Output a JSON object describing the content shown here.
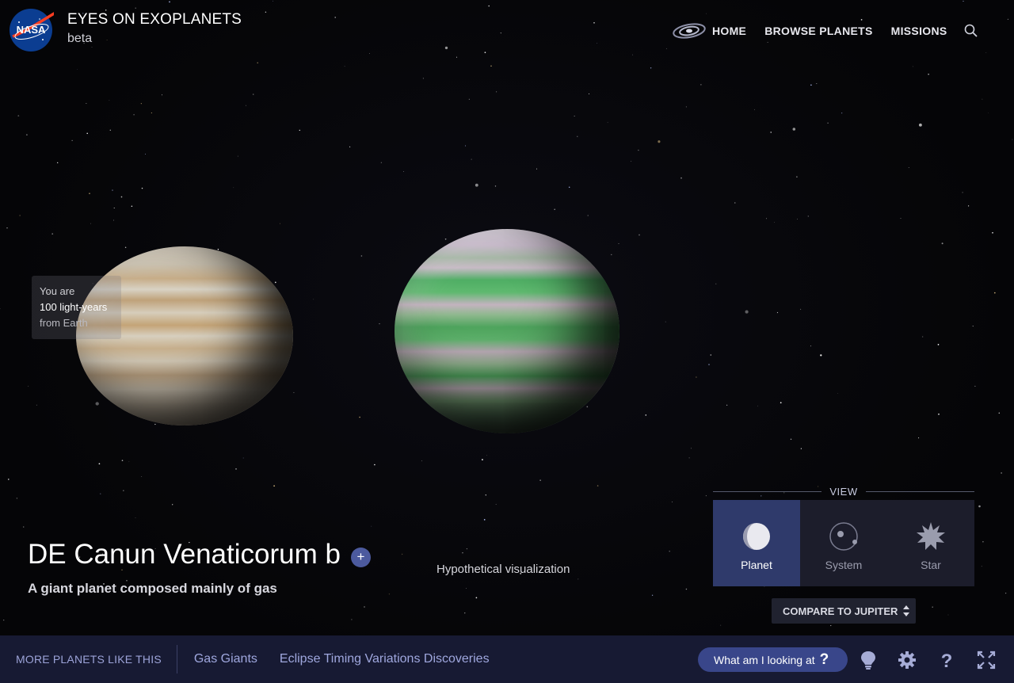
{
  "header": {
    "logo_text": "NASA",
    "app_title": "EYES ON EXOPLANETS",
    "app_subtitle": "beta",
    "nav": {
      "home": "HOME",
      "browse": "BROWSE PLANETS",
      "missions": "MISSIONS"
    },
    "icons": [
      "galaxy-icon",
      "search-icon"
    ]
  },
  "distance": {
    "line1": "You are",
    "line2": "100 light-years",
    "line3": "from Earth"
  },
  "planet": {
    "name": "DE Canun Venaticorum b",
    "add_label": "+",
    "description": "A giant planet composed mainly of gas",
    "visual_note": "Hypothetical visualization"
  },
  "view": {
    "heading": "VIEW",
    "options": [
      {
        "label": "Planet",
        "icon": "planet-icon",
        "active": true
      },
      {
        "label": "System",
        "icon": "system-icon",
        "active": false
      },
      {
        "label": "Star",
        "icon": "star-icon",
        "active": false
      }
    ],
    "compare_label": "COMPARE TO JUPITER"
  },
  "footer": {
    "more_label": "MORE PLANETS LIKE THIS",
    "links": [
      "Gas Giants",
      "Eclipse Timing Variations Discoveries"
    ],
    "what_label": "What am I looking at",
    "what_mark": "?",
    "icons": [
      "lightbulb-icon",
      "gear-icon",
      "help-icon",
      "fullscreen-icon"
    ]
  },
  "colors": {
    "footer_bg": "#171a33",
    "accent": "#39468a",
    "active_view": "#2f3a6b",
    "nasa_blue": "#0b3d91",
    "nasa_red": "#fc3d21"
  }
}
